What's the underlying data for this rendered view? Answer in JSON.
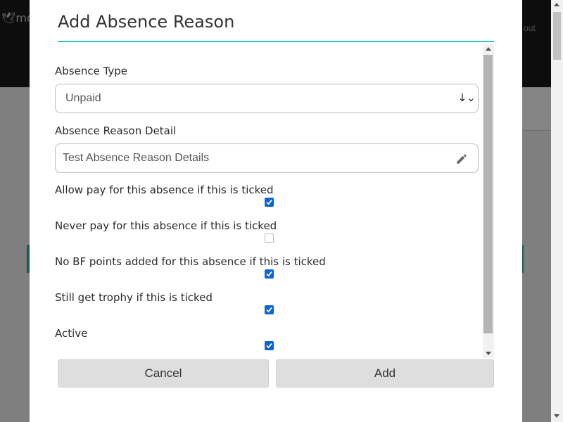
{
  "background": {
    "logo_text": "mo",
    "logout_text": "out"
  },
  "modal": {
    "title": "Add Absence Reason",
    "absence_type": {
      "label": "Absence Type",
      "selected": "Unpaid"
    },
    "reason_detail": {
      "label": "Absence Reason Detail",
      "value": "Test Absence Reason Details"
    },
    "checkboxes": [
      {
        "label": "Allow pay for this absence if this is ticked",
        "checked": true
      },
      {
        "label": "Never pay for this absence if this is ticked",
        "checked": false
      },
      {
        "label": "No BF points added for this absence if this is ticked",
        "checked": true
      },
      {
        "label": "Still get trophy if this is ticked",
        "checked": true
      },
      {
        "label": "Active",
        "checked": true
      }
    ],
    "cancel_label": "Cancel",
    "add_label": "Add"
  },
  "colors": {
    "accent_line": "#2fc2c2",
    "checkbox_checked": "#0b65d8",
    "button_bg": "#dedede"
  }
}
